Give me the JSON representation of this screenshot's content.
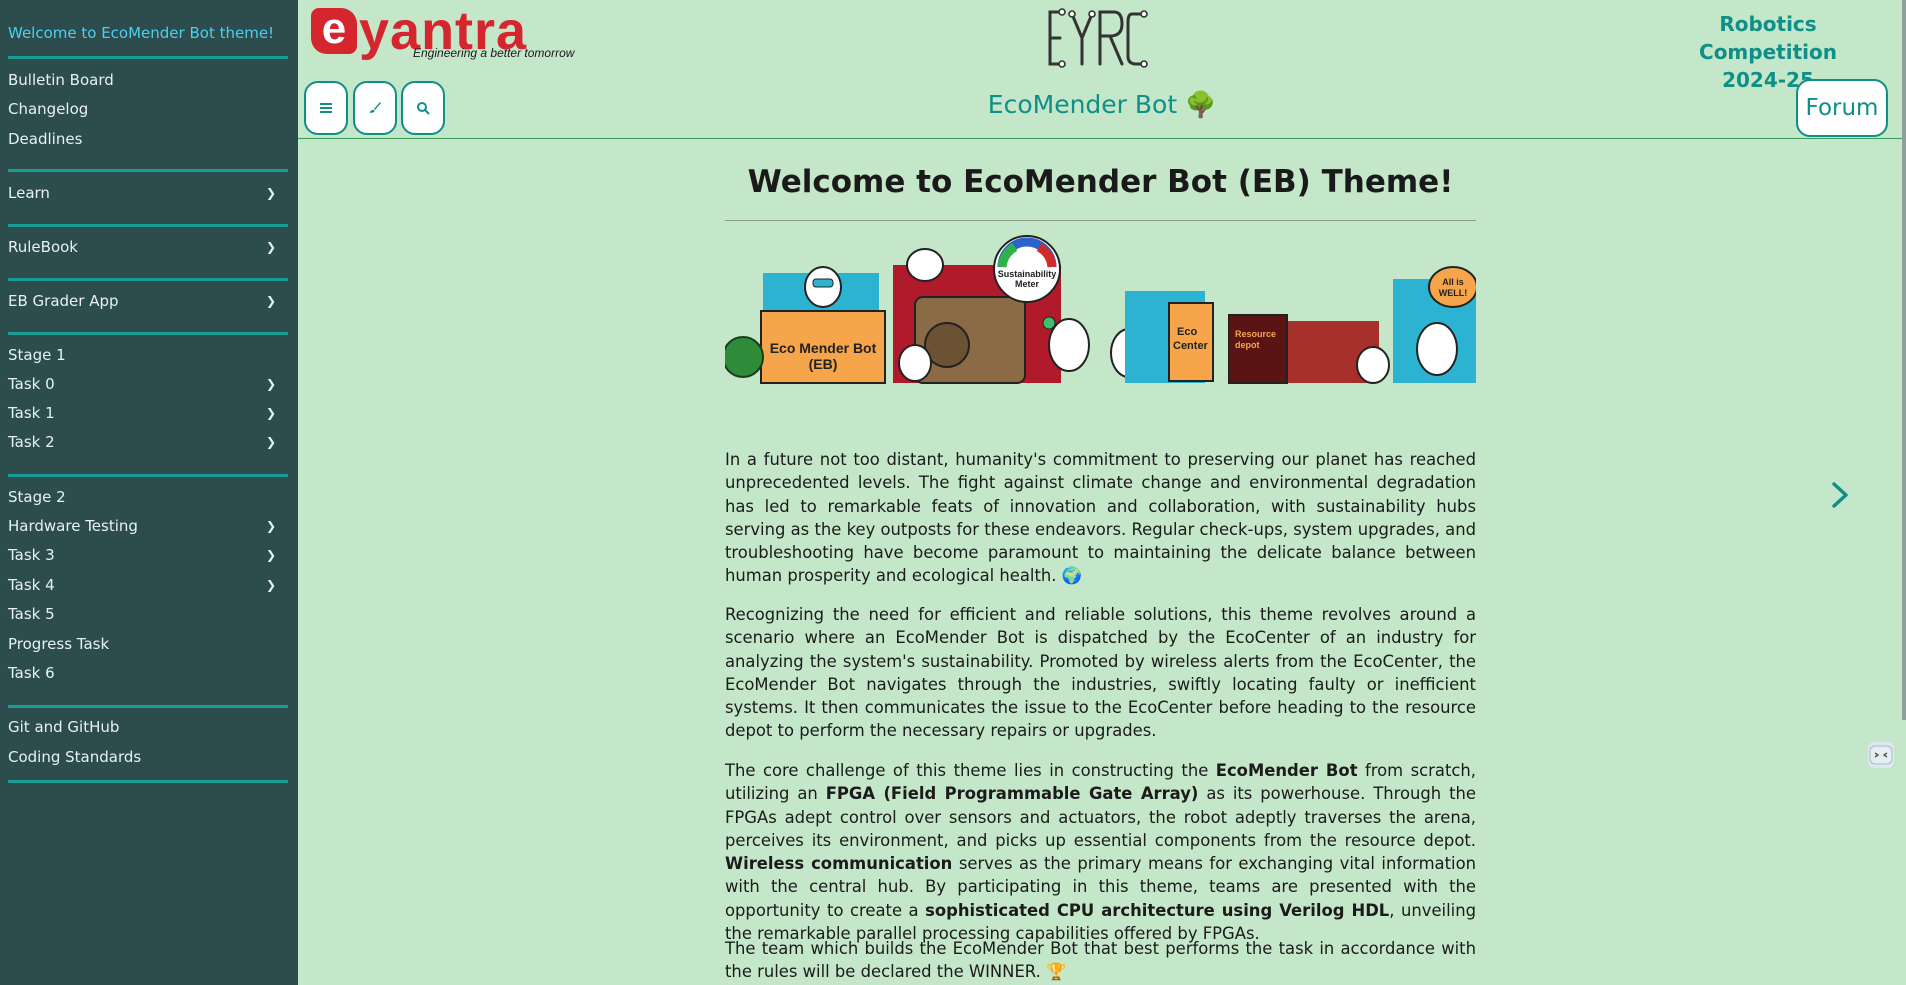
{
  "sidebar": {
    "items": [
      {
        "label": "Welcome to EcoMender Bot theme!",
        "active": true
      },
      {
        "label": "Bulletin Board"
      },
      {
        "label": "Changelog"
      },
      {
        "label": "Deadlines"
      },
      {
        "label": "Learn",
        "expandable": true
      },
      {
        "label": "RuleBook",
        "expandable": true
      },
      {
        "label": "EB Grader App",
        "expandable": true
      },
      {
        "label": "Stage 1"
      },
      {
        "label": "Task 0",
        "expandable": true
      },
      {
        "label": "Task 1",
        "expandable": true
      },
      {
        "label": "Task 2",
        "expandable": true
      },
      {
        "label": "Stage 2"
      },
      {
        "label": "Hardware Testing",
        "expandable": true
      },
      {
        "label": "Task 3",
        "expandable": true
      },
      {
        "label": "Task 4",
        "expandable": true
      },
      {
        "label": "Task 5"
      },
      {
        "label": "Progress Task"
      },
      {
        "label": "Task 6"
      },
      {
        "label": "Git and GitHub"
      },
      {
        "label": "Coding Standards"
      }
    ],
    "chevron": "❯"
  },
  "header": {
    "logo_mark": "e",
    "logo_word": "yantra",
    "logo_tagline": "Engineering a better tomorrow",
    "eyrc_logo_text": "EYRC",
    "competition_line1": "Robotics Competition",
    "competition_line2": "2024-25",
    "site_title": "EcoMender Bot 🌳",
    "menu_icon": "menu-icon",
    "theme_icon": "brush-icon",
    "search_icon": "search-icon",
    "forum_label": "Forum"
  },
  "main": {
    "heading": "Welcome to EcoMender Bot (EB) Theme!",
    "banner": {
      "eco_label_1": "Eco Mender Bot",
      "eco_label_2": "(EB)",
      "meter_label_1": "Sustainability",
      "meter_label_2": "Meter",
      "eco_center_1": "Eco",
      "eco_center_2": "Center",
      "resource_1": "Resource",
      "resource_2": "depot",
      "bubble_1": "All is",
      "bubble_2": "WELL!"
    },
    "p1": "In a future not too distant, humanity's commitment to preserving our planet has reached unprecedented levels. The fight against climate change and environmental degradation has led to remarkable feats of innovation and collaboration, with sustainability hubs serving as the key outposts for these endeavors. Regular check-ups, system upgrades, and troubleshooting have become paramount to maintaining the delicate balance between human prosperity and ecological health. 🌍",
    "p2": "Recognizing the need for efficient and reliable solutions, this theme revolves around a scenario where an EcoMender Bot is dispatched by the EcoCenter of an industry for analyzing the system's sustainability. Promoted by wireless alerts from the EcoCenter, the EcoMender Bot navigates through the industries, swiftly locating faulty or inefficient systems. It then communicates the issue to the EcoCenter before heading to the resource depot to perform the necessary repairs or upgrades.",
    "p3": {
      "t1": "The core challenge of this theme lies in constructing the ",
      "b1": "EcoMender Bot",
      "t2": " from scratch, utilizing an ",
      "b2": "FPGA (Field Programmable Gate Array)",
      "t3": " as its powerhouse. Through the FPGAs adept control over sensors and actuators, the robot adeptly traverses the arena, perceives its environment, and picks up essential components from the resource depot. ",
      "b3": "Wireless communication",
      "t4": " serves as the primary means for exchanging vital information with the central hub. By participating in this theme, teams are presented with the opportunity to create a ",
      "b4": "sophisticated CPU architecture using Verilog HDL",
      "t5": ", unveiling the remarkable parallel processing capabilities offered by FPGAs."
    },
    "p4": "The team which builds the EcoMender Bot that best performs the task in accordance with the rules will be declared the WINNER. 🏆"
  },
  "colors": {
    "sidebar_bg": "#2c4c4e",
    "page_bg": "#c4e6c9",
    "accent": "#0f8f87",
    "active_link": "#4ccff0",
    "brand_red": "#d5262f"
  }
}
